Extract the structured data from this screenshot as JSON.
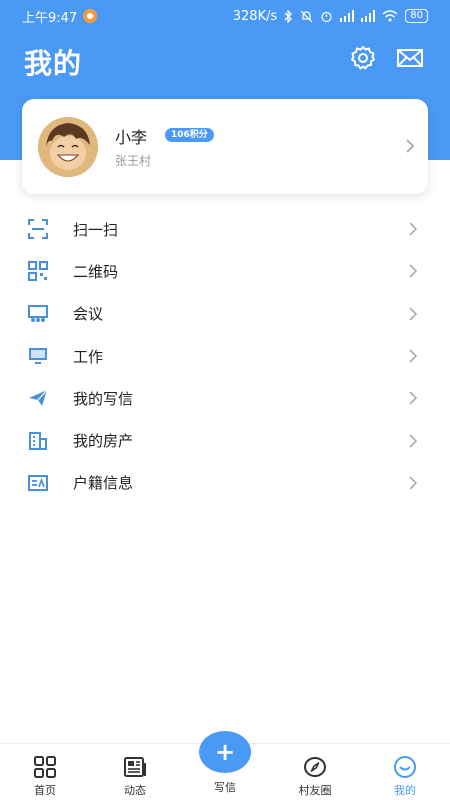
{
  "status_bar": {
    "time": "上午9:47",
    "network_speed": "328K/s",
    "battery": "80"
  },
  "header": {
    "title": "我的",
    "settings_icon": "gear-icon",
    "mail_icon": "mail-icon"
  },
  "profile": {
    "name": "小李",
    "points_badge": "106积分",
    "village": "张王村"
  },
  "menu": {
    "items": [
      {
        "label": "扫一扫",
        "icon": "scan-icon"
      },
      {
        "label": "二维码",
        "icon": "qrcode-icon"
      },
      {
        "label": "会议",
        "icon": "meeting-icon"
      },
      {
        "label": "工作",
        "icon": "work-monitor-icon"
      },
      {
        "label": "我的写信",
        "icon": "paper-plane-icon"
      },
      {
        "label": "我的房产",
        "icon": "building-icon"
      },
      {
        "label": "户籍信息",
        "icon": "id-card-icon"
      }
    ]
  },
  "tabbar": {
    "home": "首页",
    "feed": "动态",
    "compose": "写信",
    "compose_icon": "+",
    "friends": "村友圈",
    "mine": "我的",
    "active_tab": "mine"
  },
  "colors": {
    "primary": "#4a9af5",
    "icon": "#4a90d9"
  }
}
